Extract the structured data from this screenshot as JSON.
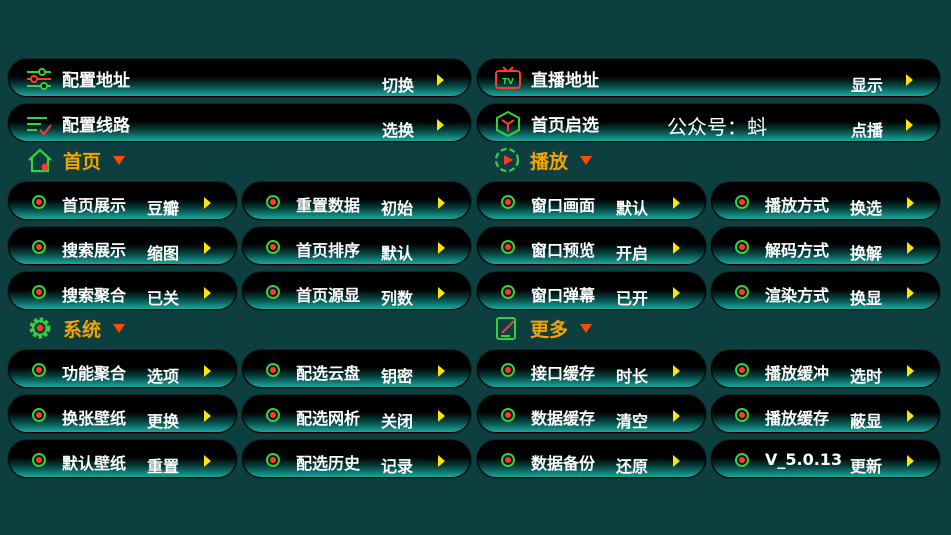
{
  "top_rows": [
    {
      "label": "配置地址",
      "action": "切换",
      "icon": "sliders-icon"
    },
    {
      "label": "直播地址",
      "action": "显示",
      "icon": "tv-icon"
    },
    {
      "label": "配置线路",
      "action": "选换",
      "icon": "list-check-icon"
    },
    {
      "label": "首页启选",
      "action": "点播",
      "icon": "hex-y-icon"
    }
  ],
  "watermark": "公众号：蚪",
  "sections": [
    {
      "title": "首页",
      "icon": "home-icon"
    },
    {
      "title": "播放",
      "icon": "play-circle-icon"
    },
    {
      "title": "系统",
      "icon": "gear-icon"
    },
    {
      "title": "更多",
      "icon": "edit-icon"
    }
  ],
  "home_items": [
    {
      "label": "首页展示",
      "action": "豆瓣"
    },
    {
      "label": "重置数据",
      "action": "初始"
    },
    {
      "label": "搜索展示",
      "action": "缩图"
    },
    {
      "label": "首页排序",
      "action": "默认"
    },
    {
      "label": "搜索聚合",
      "action": "已关"
    },
    {
      "label": "首页源显",
      "action": "列数"
    }
  ],
  "play_items": [
    {
      "label": "窗口画面",
      "action": "默认"
    },
    {
      "label": "播放方式",
      "action": "换选"
    },
    {
      "label": "窗口预览",
      "action": "开启"
    },
    {
      "label": "解码方式",
      "action": "换解"
    },
    {
      "label": "窗口弹幕",
      "action": "已开"
    },
    {
      "label": "渲染方式",
      "action": "换显"
    }
  ],
  "system_items": [
    {
      "label": "功能聚合",
      "action": "选项"
    },
    {
      "label": "配选云盘",
      "action": "钥密"
    },
    {
      "label": "换张壁纸",
      "action": "更换"
    },
    {
      "label": "配选网析",
      "action": "关闭"
    },
    {
      "label": "默认壁纸",
      "action": "重置"
    },
    {
      "label": "配选历史",
      "action": "记录"
    }
  ],
  "more_items": [
    {
      "label": "接口缓存",
      "action": "时长"
    },
    {
      "label": "播放缓冲",
      "action": "选时"
    },
    {
      "label": "数据缓存",
      "action": "清空"
    },
    {
      "label": "播放缓存",
      "action": "蔽显"
    },
    {
      "label": "数据备份",
      "action": "还原"
    },
    {
      "label": "V_5.0.13",
      "action": "更新"
    }
  ],
  "colors": {
    "background": "#0d3f40",
    "accent_orange": "#f5a300",
    "caret_red": "#ff4d00",
    "arrow_yellow": "#ffe600",
    "icon_green": "#35d23b",
    "icon_red": "#ff3a2a"
  }
}
